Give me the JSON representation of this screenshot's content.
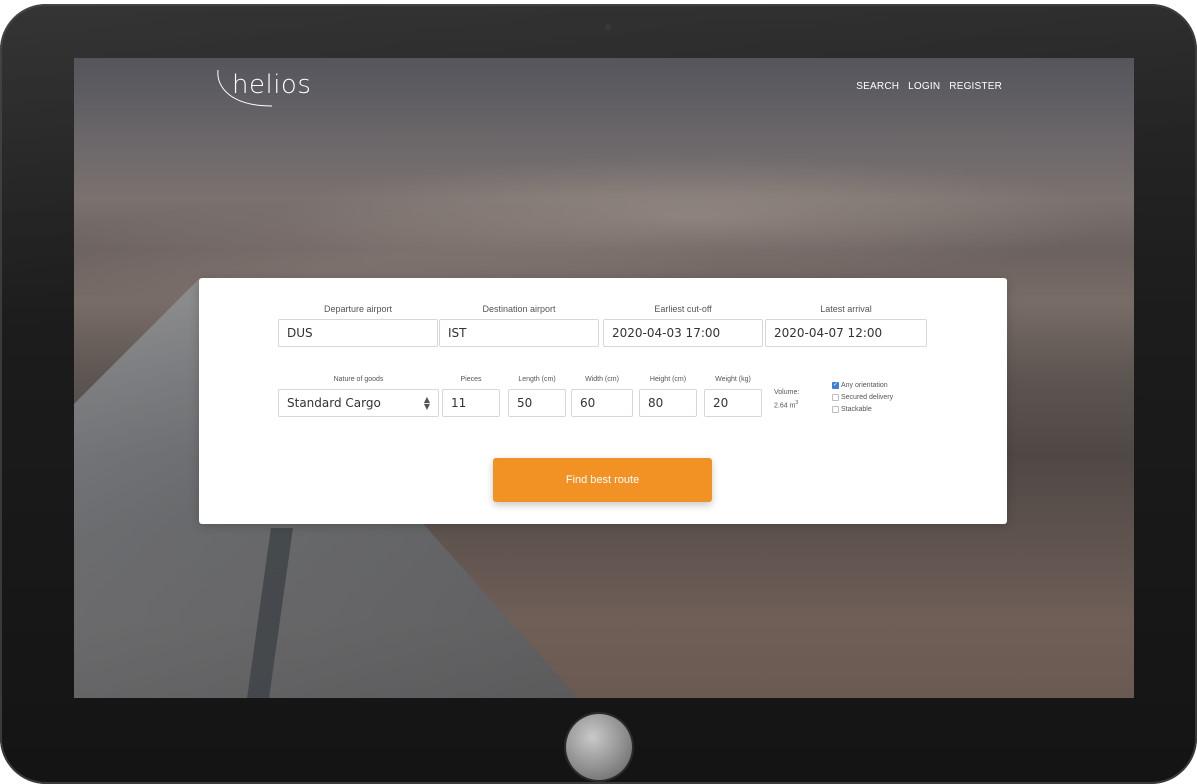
{
  "brand": {
    "name": "helios",
    "accent_color": "#f39224"
  },
  "nav": {
    "items": [
      "SEARCH",
      "LOGIN",
      "REGISTER"
    ]
  },
  "search_form": {
    "departure_label": "Departure airport",
    "departure_value": "DUS",
    "destination_label": "Destination airport",
    "destination_value": "IST",
    "cutoff_label": "Earliest cut-off",
    "cutoff_value": "2020-04-03 17:00",
    "arrival_label": "Latest arrival",
    "arrival_value": "2020-04-07 12:00",
    "nature_label": "Nature of goods",
    "nature_value": "Standard Cargo",
    "pieces_label": "Pieces",
    "pieces_value": "11",
    "length_label": "Length (cm)",
    "length_value": "50",
    "width_label": "Width (cm)",
    "width_value": "60",
    "height_label": "Height (cm)",
    "height_value": "80",
    "weight_label": "Weight (kg)",
    "weight_value": "20",
    "volume_label": "Volume:",
    "volume_value": "2.64 m",
    "volume_unit_exp": "3",
    "options": [
      {
        "label": "Any orientation",
        "checked": true
      },
      {
        "label": "Secured delivery",
        "checked": false
      },
      {
        "label": "Stackable",
        "checked": false
      }
    ],
    "submit_label": "Find best route"
  },
  "icons": {
    "checkbox_checked": "checkmark-icon",
    "select": "select-arrows-icon"
  }
}
